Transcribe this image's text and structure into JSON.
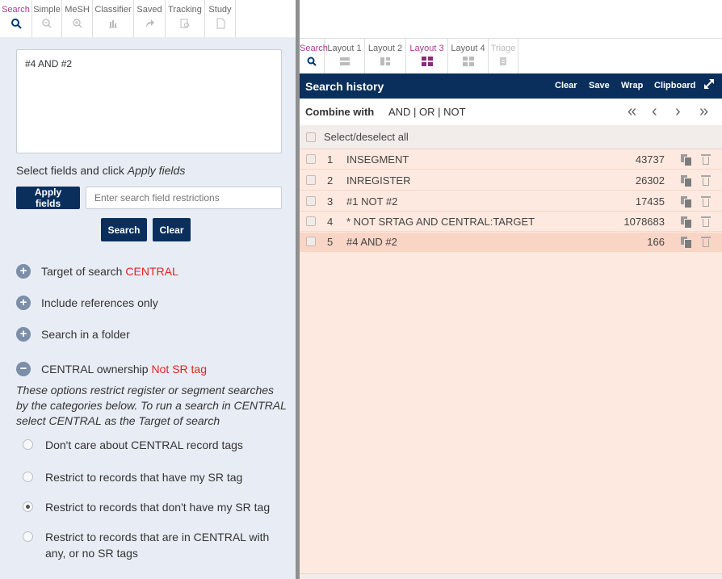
{
  "left_tabs": [
    {
      "label": "Search",
      "icon": "search-icon"
    },
    {
      "label": "Simple",
      "icon": "zoom-out-icon"
    },
    {
      "label": "MeSH",
      "icon": "zoom-in-icon"
    },
    {
      "label": "Classifier",
      "icon": "bar-chart-icon"
    },
    {
      "label": "Saved",
      "icon": "share-arrow-icon"
    },
    {
      "label": "Tracking",
      "icon": "tracking-icon"
    },
    {
      "label": "Study",
      "icon": "document-icon"
    }
  ],
  "query": {
    "text": "#4 AND #2"
  },
  "fields": {
    "prompt": "Select fields and click ",
    "prompt_em": "Apply fields",
    "apply_label": "Apply fields",
    "restrict_placeholder": "Enter search field restrictions"
  },
  "buttons": {
    "search": "Search",
    "clear": "Clear"
  },
  "options": [
    {
      "label": "Target of search",
      "value": "CENTRAL",
      "icon": "plus-circle-icon"
    },
    {
      "label": "Include references only",
      "value": "",
      "icon": "plus-circle-icon"
    },
    {
      "label": "Search in a folder",
      "value": "",
      "icon": "plus-circle-icon"
    },
    {
      "label": "CENTRAL ownership",
      "value": "Not SR tag",
      "icon": "minus-circle-icon"
    }
  ],
  "ownership": {
    "description": "These options restrict register or segment searches by the categories below. To run a search in CENTRAL select CENTRAL as the Target of search",
    "radios": [
      {
        "label": "Don't care about CENTRAL record tags",
        "checked": false
      },
      {
        "label": "Restrict to records that have my SR tag",
        "checked": false
      },
      {
        "label": "Restrict to records that don't have my SR tag",
        "checked": true
      },
      {
        "label": "Restrict to records that are in CENTRAL with any, or no SR tags",
        "checked": false
      }
    ]
  },
  "right_tabs": [
    {
      "label": "Search",
      "icon": "search-icon"
    },
    {
      "label": "Layout 1",
      "icon": "layout-1-icon"
    },
    {
      "label": "Layout 2",
      "icon": "layout-2-icon"
    },
    {
      "label": "Layout 3",
      "icon": "layout-3-icon"
    },
    {
      "label": "Layout 4",
      "icon": "layout-4-icon"
    },
    {
      "label": "Triage",
      "icon": "triage-icon"
    }
  ],
  "history": {
    "title": "Search history",
    "actions": [
      "Clear",
      "Save",
      "Wrap",
      "Clipboard"
    ],
    "combine_label": "Combine with",
    "combine_ops": "AND | OR | NOT",
    "select_all": "Select/deselect all",
    "rows": [
      {
        "num": "1",
        "query": "INSEGMENT",
        "count": "43737",
        "selected": false
      },
      {
        "num": "2",
        "query": "INREGISTER",
        "count": "26302",
        "selected": false
      },
      {
        "num": "3",
        "query": "#1 NOT #2",
        "count": "17435",
        "selected": false
      },
      {
        "num": "4",
        "query": "* NOT SRTAG AND CENTRAL:TARGET",
        "count": "1078683",
        "selected": false
      },
      {
        "num": "5",
        "query": "#4 AND #2",
        "count": "166",
        "selected": true
      }
    ]
  },
  "colors": {
    "navy": "#0a2f5c",
    "accent": "#b03a92",
    "red": "#e3231f",
    "history_bg": "#fde9df"
  }
}
